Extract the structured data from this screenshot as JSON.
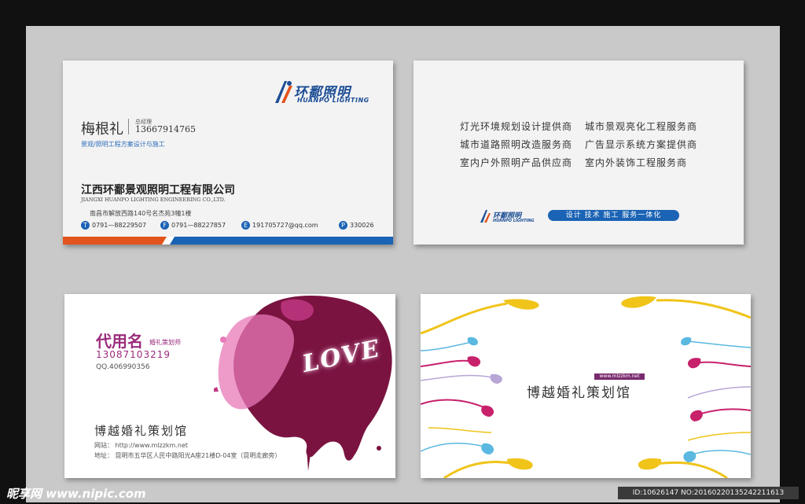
{
  "card1": {
    "logo_cn": "环鄱照明",
    "logo_en": "HUANPO LIGHTING",
    "name": "梅根礼",
    "title": "总经理",
    "phone": "13667914765",
    "tagline": "景观/照明工程方案设计与施工",
    "company_cn": "江西环鄱景观照明工程有限公司",
    "company_en": "JIANGXI HUANPO LIGHTING ENGINEERING CO.,LTD.",
    "address": "南昌市解放西路140号名杰苑3幢1楼",
    "contacts": [
      {
        "icon": "T",
        "text": "0791—88229507"
      },
      {
        "icon": "F",
        "text": "0791—88227857"
      },
      {
        "icon": "E",
        "text": "191705727@qq.com"
      },
      {
        "icon": "P",
        "text": "330026"
      }
    ],
    "colors": {
      "accent_blue": "#1b63b4",
      "accent_orange": "#e2541c"
    }
  },
  "card2": {
    "services": [
      "灯光环境规划设计提供商",
      "城市景观亮化工程服务商",
      "城市道路照明改造服务商",
      "广告显示系统方案提供商",
      "室内户外照明产品供应商",
      "室内外装饰工程服务商"
    ],
    "logo_cn": "环鄱照明",
    "logo_en": "HUANPO LIGHTING",
    "slogan": "设计 技术 施工 服务一体化"
  },
  "card3": {
    "name": "代用名",
    "title": "婚礼策划师",
    "phone": "13087103219",
    "qq": "QQ.406990356",
    "love": "LOVE",
    "shop": "博越婚礼策划馆",
    "website": "网站： http://www.mlzzkm.net",
    "address": "地址： 昆明市五华区人民中路阳光A座21楼D-04室（昆明走廊旁）",
    "colors": {
      "accent": "#9b2b7c",
      "ink": "#7a1340"
    }
  },
  "card4": {
    "url": "www.mlzzkm.net",
    "shop": "博越婚礼策划馆"
  },
  "watermark": {
    "site": "昵享网 www.nipic.com",
    "id": "ID:10626147 NO:20160220135242211613"
  }
}
